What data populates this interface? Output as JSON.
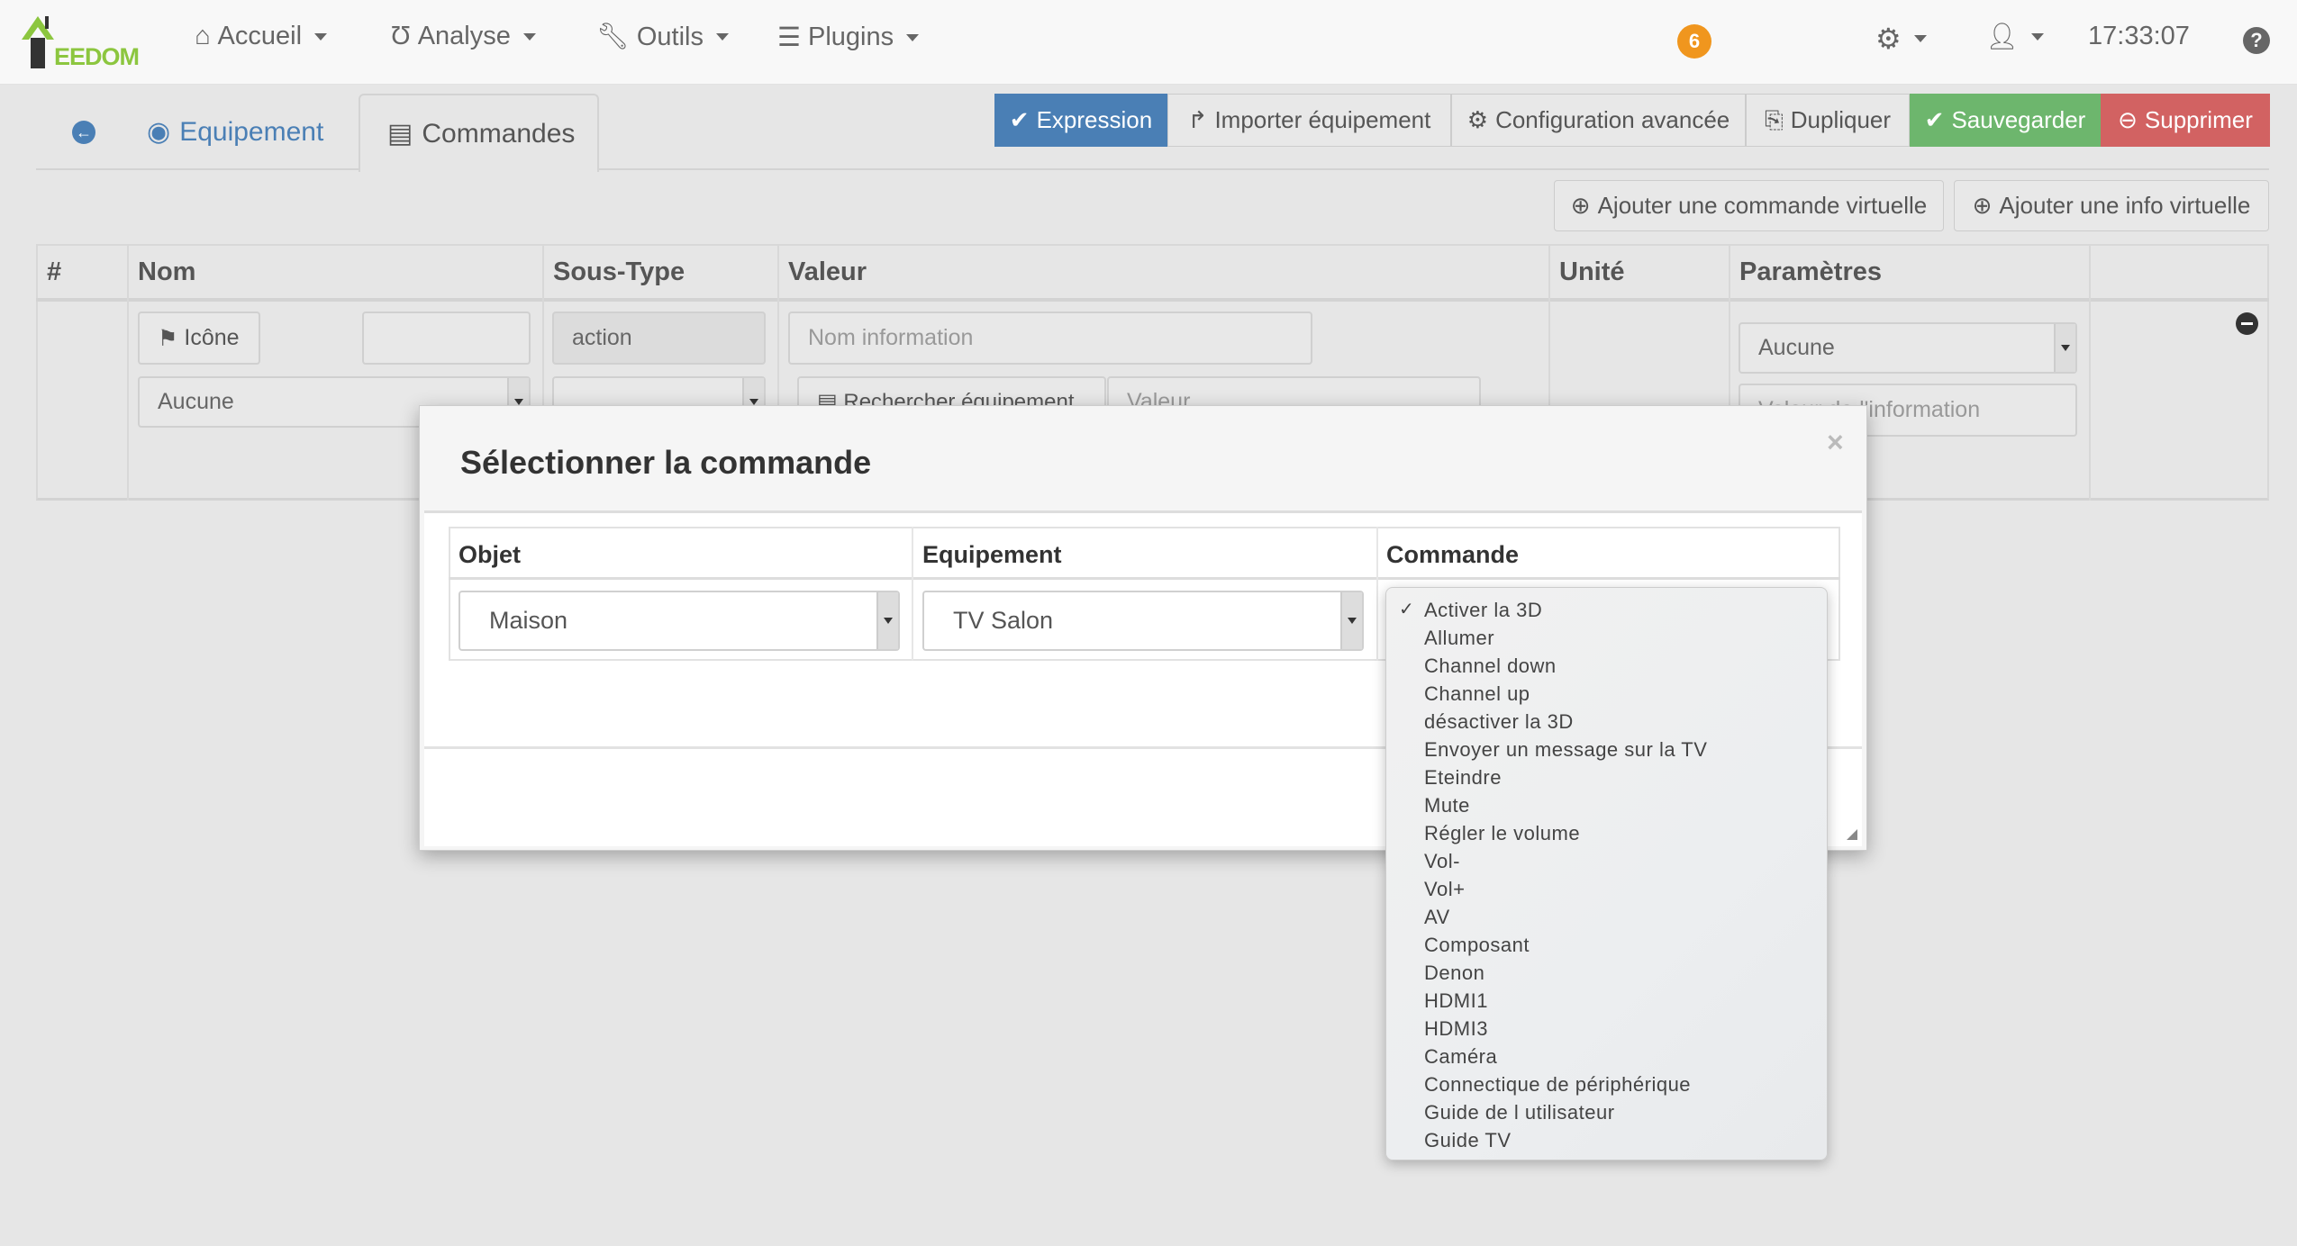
{
  "navbar": {
    "logo_text": "EEDOM",
    "items": [
      {
        "label": "Accueil",
        "icon": "home-icon"
      },
      {
        "label": "Analyse",
        "icon": "stethoscope-icon"
      },
      {
        "label": "Outils",
        "icon": "wrench-icon"
      },
      {
        "label": "Plugins",
        "icon": "tasks-icon"
      }
    ],
    "notification_count": "6",
    "time": "17:33:07"
  },
  "tabs": {
    "equipement": "Equipement",
    "commandes": "Commandes"
  },
  "actions": {
    "expression": "Expression",
    "importer": "Importer équipement",
    "config": "Configuration avancée",
    "dupliquer": "Dupliquer",
    "sauvegarder": "Sauvegarder",
    "supprimer": "Supprimer",
    "add_command": "Ajouter une commande virtuelle",
    "add_info": "Ajouter une info virtuelle"
  },
  "colors": {
    "primary": "#4a7fb5",
    "success": "#6db66d",
    "danger": "#d26262",
    "badge": "#f0961e"
  },
  "table": {
    "headers": [
      "#",
      "Nom",
      "Sous-Type",
      "Valeur",
      "Unité",
      "Paramètres"
    ],
    "row": {
      "icon_button": "Icône",
      "type_value": "action",
      "name_info_placeholder": "Nom information",
      "nom_select": "Aucune",
      "search_button": "Rechercher équipement",
      "value_placeholder": "Valeur",
      "param_select": "Aucune",
      "param_info_placeholder": "Valeur de l'information"
    }
  },
  "modal": {
    "title": "Sélectionner la commande",
    "headers": [
      "Objet",
      "Equipement",
      "Commande"
    ],
    "objet": "Maison",
    "equipement": "TV Salon",
    "commande_options": [
      "Activer la 3D",
      "Allumer",
      "Channel down",
      "Channel up",
      "désactiver la 3D",
      "Envoyer un message sur la TV",
      "Eteindre",
      "Mute",
      "Régler le volume",
      "Vol-",
      "Vol+",
      "AV",
      "Composant",
      "Denon",
      "HDMI1",
      "HDMI3",
      "Caméra",
      "Connectique de périphérique",
      "Guide de l utilisateur",
      "Guide TV"
    ],
    "selected": "Activer la 3D"
  }
}
